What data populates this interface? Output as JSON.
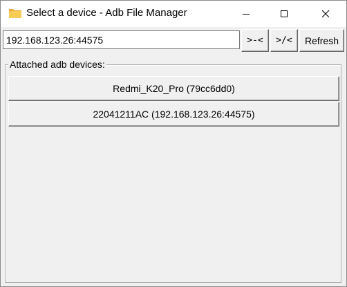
{
  "window": {
    "title": "Select a device - Adb File Manager",
    "icon": "folder-icon",
    "controls": [
      "minimize-icon",
      "maximize-icon",
      "close-icon"
    ]
  },
  "toolbar": {
    "address_value": "192.168.123.26:44575",
    "connect_label": ">-<",
    "disconnect_label": ">/<",
    "refresh_label": "Refresh"
  },
  "devices_group": {
    "label": "Attached adb devices:",
    "items": [
      {
        "label": "Redmi_K20_Pro (79cc6dd0)"
      },
      {
        "label": "22041211AC (192.168.123.26:44575)"
      }
    ]
  },
  "colors": {
    "background": "#f0f0f0",
    "titlebar": "#ffffff",
    "folder": "#f5c242"
  }
}
